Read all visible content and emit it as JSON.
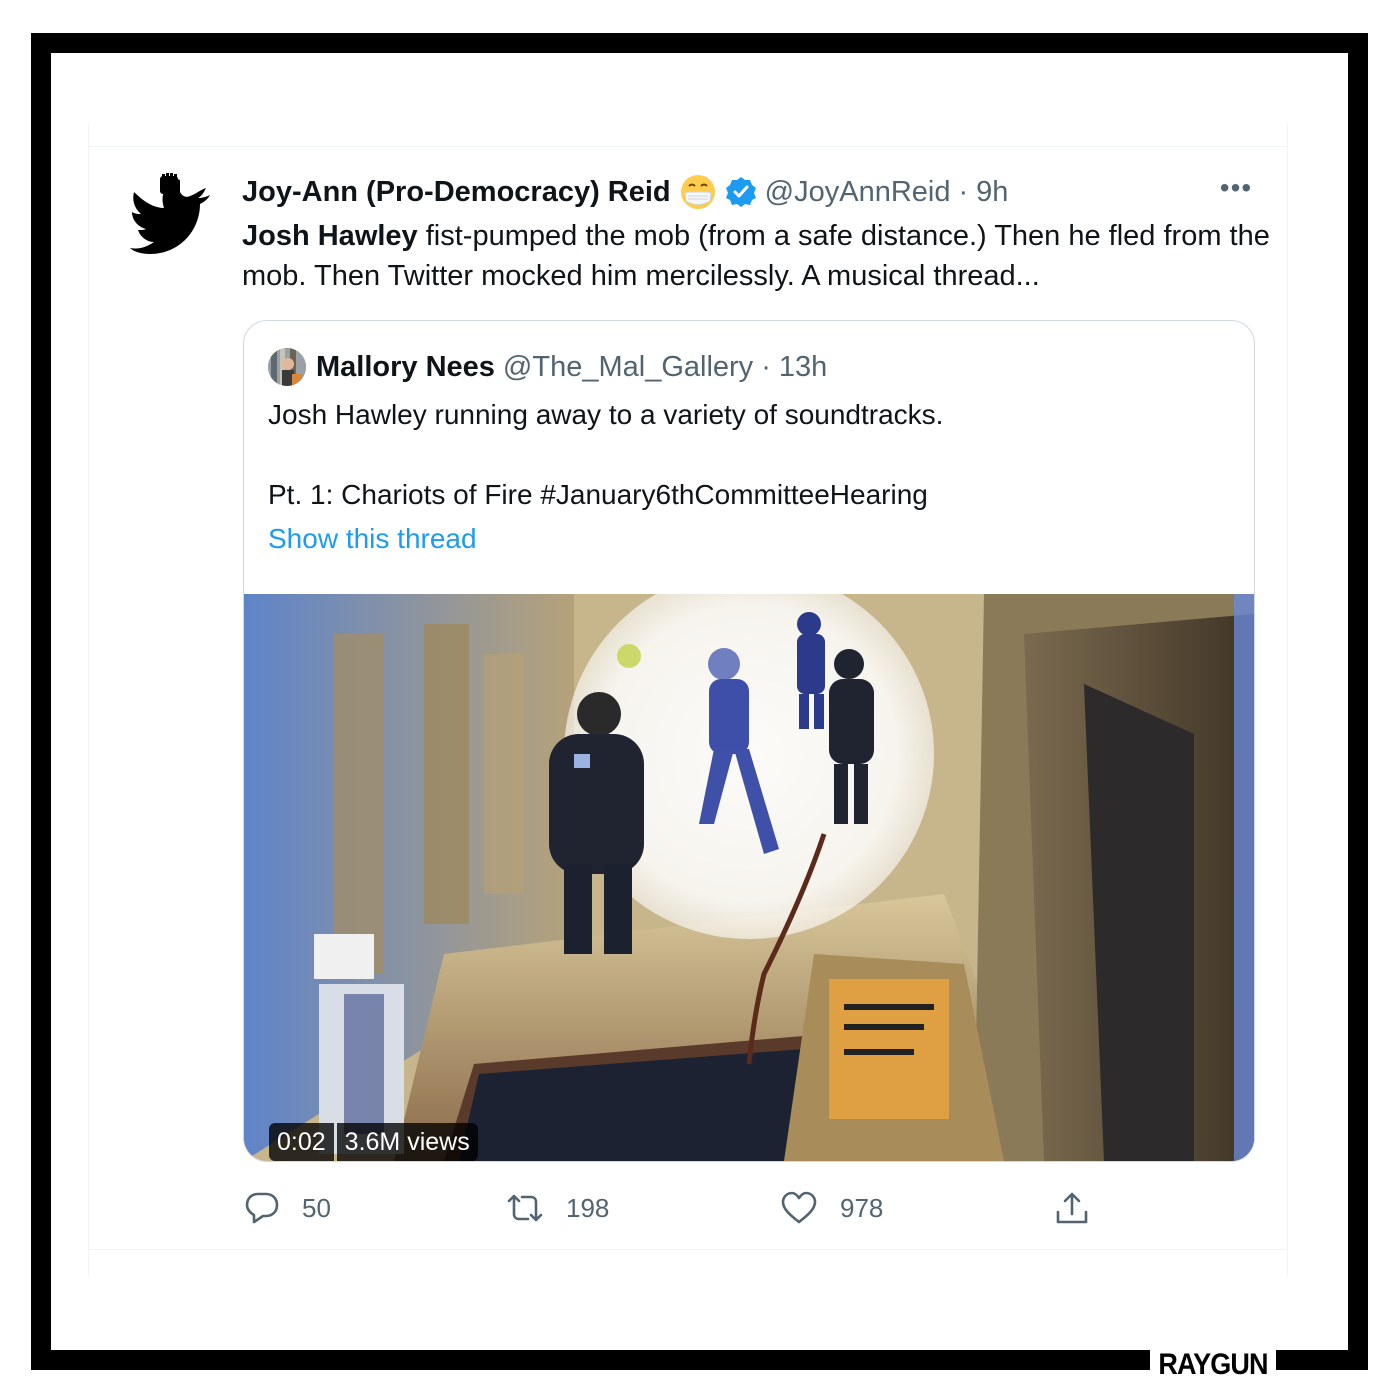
{
  "tweet": {
    "display_name": "Joy-Ann (Pro-Democracy) Reid",
    "handle": "@JoyAnnReid",
    "separator": "·",
    "time": "9h",
    "more_label": "•••",
    "body_bold": "Josh Hawley",
    "body_rest": " fist-pumped the mob (from a safe distance.) Then he fled from the mob. Then Twitter mocked him mercilessly. A musical thread..."
  },
  "quoted_tweet": {
    "display_name": "Mallory Nees",
    "handle": "@The_Mal_Gallery",
    "separator": "·",
    "time": "13h",
    "text_line1": "Josh Hawley running away to a variety of soundtracks.",
    "text_line2": "Pt. 1: Chariots of Fire #January6thCommitteeHearing",
    "show_thread": "Show this thread",
    "video": {
      "duration": "0:02",
      "views": "3.6M views"
    }
  },
  "actions": {
    "replies": "50",
    "retweets": "198",
    "likes": "978"
  },
  "brand": "RAYGUN",
  "colors": {
    "accent_link": "#1d9bf0",
    "verified_badge": "#1d9bf0",
    "secondary_text": "#536471",
    "frame": "#000000"
  },
  "icons": [
    "raised-fist-twitter-bird-logo",
    "face-with-medical-mask-emoji",
    "verified-badge-icon",
    "more-icon",
    "reply-icon",
    "retweet-icon",
    "like-icon",
    "share-icon"
  ]
}
